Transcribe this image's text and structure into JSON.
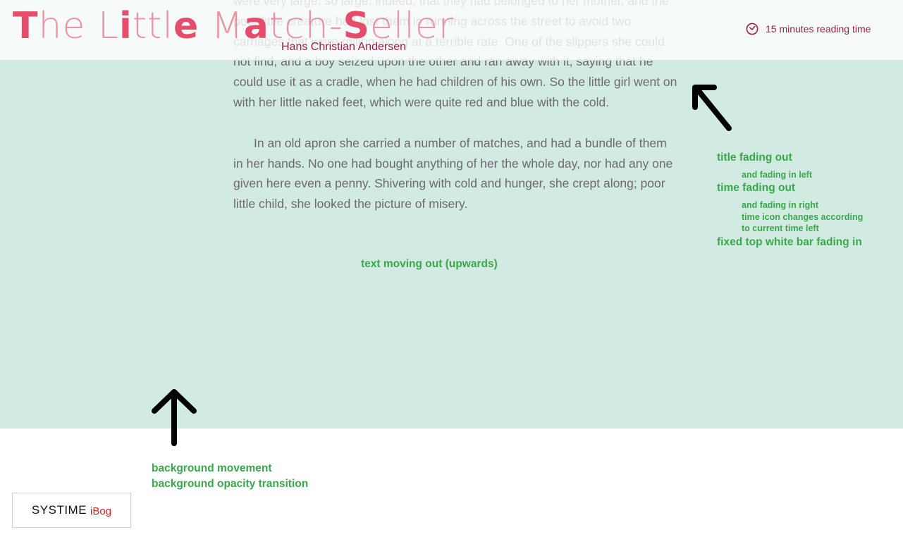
{
  "story": {
    "paragraphs": [
      "were very large, so large, indeed, that they had belonged to her mother, and the poor little creature had lost them in running across the street to avoid two carriages that were rolling along at a terrible rate. One of the slippers she could not find, and a boy seized upon the other and ran away with it, saying that he could use it as a cradle, when he had children of his own. So the little girl went on with her little naked feet, which were quite red and blue with the cold.",
      "In an old apron she carried a number of matches, and had a bundle of them in her hands. No one had bought anything of her the whole day, nor had any one given here even a penny. Shivering with cold and hunger, she crept along; poor little child, she looked the picture of misery."
    ]
  },
  "header": {
    "title_parts": [
      "T",
      "he L",
      "i",
      "ttl",
      "e",
      " M",
      "a",
      "tch-",
      "S",
      "eller"
    ],
    "author": "Hans Christian Andersen",
    "reading_time": "15 minutes reading time",
    "reading_icon": "clock-icon"
  },
  "annotations": {
    "title_fading_out": "title fading out",
    "and_fading_in_left": "and fading in left",
    "time_fading_out": "time fading out",
    "and_fading_in_right": "and fading in right",
    "time_icon_changes_1": "time icon changes according",
    "time_icon_changes_2": "to current time left",
    "fixed_top_bar": "fixed top white bar fading in",
    "text_moving_out": "text moving out (upwards)",
    "background_movement": "background movement",
    "background_opacity": "background opacity transition"
  },
  "logo": {
    "brand": "SYSTIME",
    "product": "iBog"
  },
  "colors": {
    "background_panel": "#d2ebe2",
    "title_accent": "#e54d6b",
    "author": "#9b1f45",
    "annotation": "#3aa84a"
  }
}
